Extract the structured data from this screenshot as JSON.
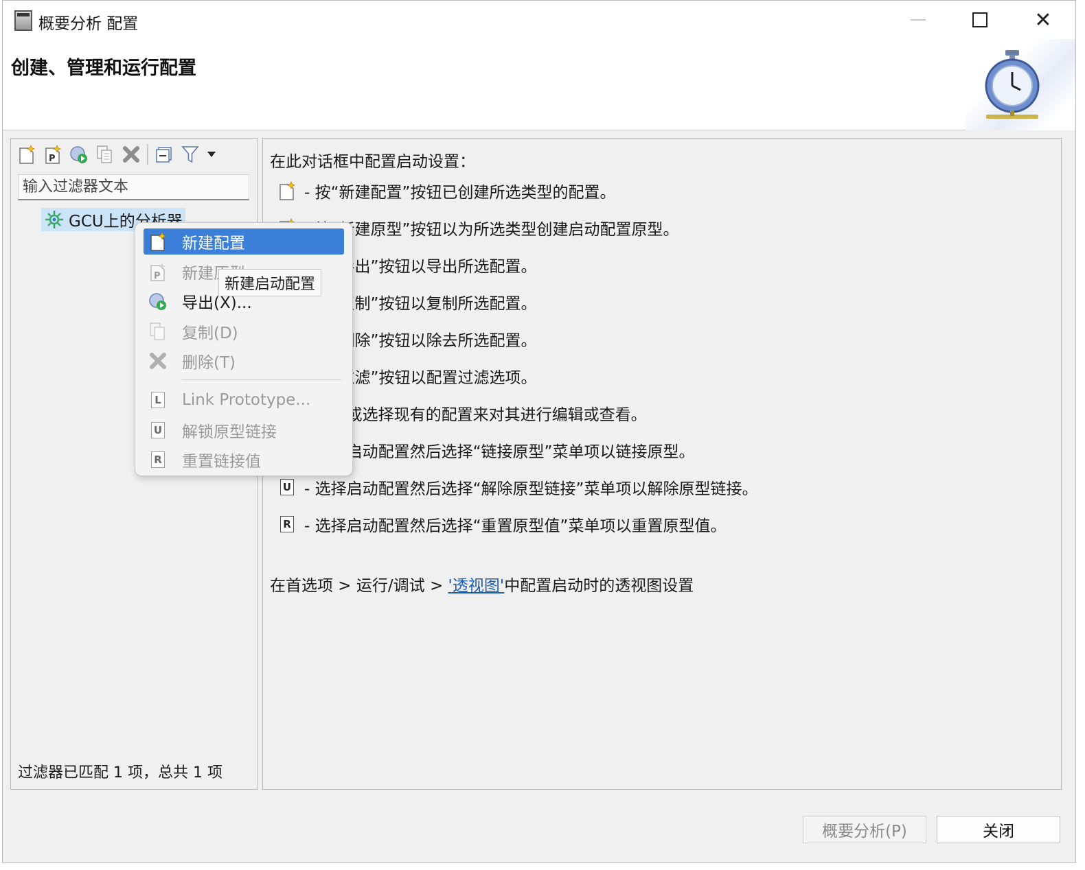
{
  "window": {
    "title": "概要分析 配置",
    "controls": [
      "minimize",
      "maximize",
      "close"
    ]
  },
  "header": {
    "title": "创建、管理和运行配置",
    "art_icon": "stopwatch-icon"
  },
  "left_panel": {
    "toolbar": [
      {
        "name": "new-config-icon"
      },
      {
        "name": "new-prototype-icon"
      },
      {
        "name": "export-icon"
      },
      {
        "name": "duplicate-icon"
      },
      {
        "name": "delete-icon"
      },
      {
        "name": "collapse-all-icon"
      },
      {
        "name": "filter-icon"
      },
      {
        "name": "filter-dropdown-icon"
      }
    ],
    "filter_placeholder": "输入过滤器文本",
    "tree": [
      {
        "label": "GCU上的分析器",
        "icon": "analyzer-icon",
        "selected": true
      }
    ],
    "status": "过滤器已匹配 1 项，总共 1 项"
  },
  "right_panel": {
    "intro": "在此对话框中配置启动设置：",
    "rows": [
      {
        "icon": "new-config-icon",
        "text": "- 按“新建配置”按钮已创建所选类型的配置。"
      },
      {
        "icon": "new-prototype-icon",
        "text": "- 按“新建原型”按钮以为所选类型创建启动配置原型。"
      },
      {
        "icon": "export-icon",
        "text": "- 按“导出”按钮以导出所选配置。"
      },
      {
        "icon": "duplicate-icon",
        "text": "- 按“复制”按钮以复制所选配置。"
      },
      {
        "icon": "delete-icon",
        "text": "- 按“删除”按钮以除去所选配置。"
      },
      {
        "icon": "filter-icon",
        "text": "- 按“过滤”按钮以配置过滤选项。"
      },
      {
        "icon": "edit-icon",
        "text": "- 编辑或选择现有的配置来对其进行编辑或查看。"
      },
      {
        "icon": "link-icon",
        "letter": "L",
        "text": "- 选择启动配置然后选择“链接原型”菜单项以链接原型。"
      },
      {
        "icon": "unlink-icon",
        "letter": "U",
        "text": "- 选择启动配置然后选择“解除原型链接”菜单项以解除原型链接。"
      },
      {
        "icon": "reset-icon",
        "letter": "R",
        "text": "- 选择启动配置然后选择“重置原型值”菜单项以重置原型值。"
      }
    ],
    "pref_prefix": "在首选项 > 运行/调试 > ",
    "pref_link": "'透视图'",
    "pref_suffix": "中配置启动时的透视图设置"
  },
  "context_menu": {
    "items": [
      {
        "label": "新建配置",
        "icon": "new-config-icon",
        "state": "selected"
      },
      {
        "label": "新建原型",
        "icon": "new-prototype-icon",
        "state": "disabled"
      },
      {
        "label": "导出(X)...",
        "icon": "export-icon",
        "state": "enabled"
      },
      {
        "label": "复制(D)",
        "icon": "duplicate-icon",
        "state": "disabled"
      },
      {
        "label": "删除(T)",
        "icon": "delete-icon",
        "state": "disabled"
      },
      {
        "label": "Link Prototype...",
        "icon": "link-icon",
        "letter": "L",
        "state": "disabled"
      },
      {
        "label": "解锁原型链接",
        "icon": "unlink-icon",
        "letter": "U",
        "state": "disabled"
      },
      {
        "label": "重置链接值",
        "icon": "reset-icon",
        "letter": "R",
        "state": "disabled"
      }
    ]
  },
  "tooltip": "新建启动配置",
  "buttons": {
    "profile": "概要分析(P)",
    "close": "关闭"
  }
}
